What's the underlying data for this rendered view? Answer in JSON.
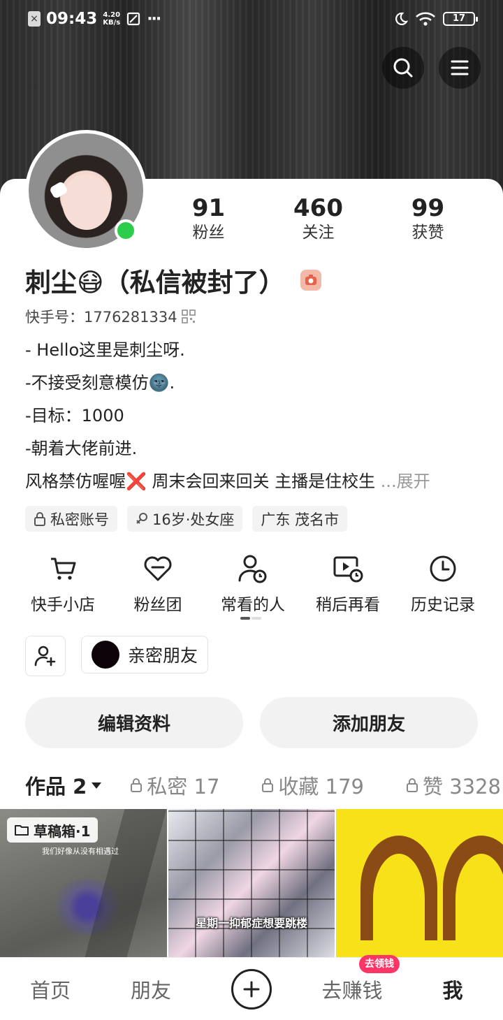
{
  "status_bar": {
    "time": "09:43",
    "speed_value": "4.20",
    "speed_unit": "KB/s",
    "dots": "···",
    "battery": "17"
  },
  "profile": {
    "stats": [
      {
        "value": "91",
        "label": "粉丝"
      },
      {
        "value": "460",
        "label": "关注"
      },
      {
        "value": "99",
        "label": "获赞"
      }
    ],
    "name": "刺尘😷（私信被封了）",
    "kuaishou_id": "快手号：1776281334",
    "bio": [
      "- Hello这里是刺尘呀.",
      "-不接受刻意模仿🌚.",
      "-目标：1000",
      "-朝着大佬前进.",
      "风格禁仿喔喔❌ 周末会回来回关 主播是住校生 "
    ],
    "bio_expand": "...展开",
    "tags": [
      "私密账号",
      "16岁·处女座",
      "广东 茂名市"
    ]
  },
  "tools": [
    {
      "label": "快手小店",
      "icon": "cart-icon"
    },
    {
      "label": "粉丝团",
      "icon": "heart-icon"
    },
    {
      "label": "常看的人",
      "icon": "person-clock-icon"
    },
    {
      "label": "稍后再看",
      "icon": "video-clock-icon"
    },
    {
      "label": "历史记录",
      "icon": "clock-icon"
    }
  ],
  "close_friend_label": "亲密朋友",
  "buttons": {
    "edit": "编辑资料",
    "add_friend": "添加朋友"
  },
  "tabs": [
    {
      "label": "作品 2"
    },
    {
      "label": "私密 17"
    },
    {
      "label": "收藏 179"
    },
    {
      "label": "赞 3328"
    }
  ],
  "grid": {
    "draft_label": "草稿箱·1",
    "cell1_caption": "我们好像从没有相遇过",
    "cell2_caption": "星期一抑郁症想要跳楼"
  },
  "bottom_nav": {
    "home": "首页",
    "friends": "朋友",
    "earn": "去赚钱",
    "earn_badge": "去领钱",
    "me": "我"
  },
  "colors": {
    "online": "#2ccd4a",
    "badge": "#fe3666",
    "close_friend_dot": "#0d0208"
  }
}
